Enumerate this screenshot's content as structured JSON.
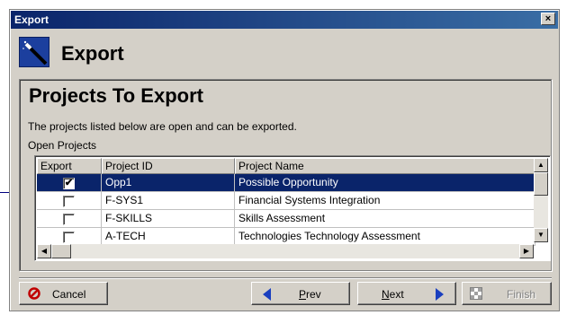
{
  "window": {
    "title": "Export",
    "close_glyph": "×"
  },
  "header": {
    "title": "Export",
    "icon": "wand-icon"
  },
  "panel": {
    "title": "Projects To Export",
    "description": "The projects listed below are open and can be exported.",
    "list_label": "Open Projects"
  },
  "table": {
    "columns": [
      "Export",
      "Project ID",
      "Project Name"
    ],
    "rows": [
      {
        "checked": true,
        "id": "Opp1",
        "name": "Possible Opportunity",
        "selected": true
      },
      {
        "checked": false,
        "id": "F-SYS1",
        "name": "Financial Systems Integration",
        "selected": false
      },
      {
        "checked": false,
        "id": "F-SKILLS",
        "name": "Skills Assessment",
        "selected": false
      },
      {
        "checked": false,
        "id": "A-TECH",
        "name": "Technologies Technology Assessment",
        "selected": false
      }
    ]
  },
  "buttons": {
    "cancel": "Cancel",
    "prev_u": "P",
    "prev_rest": "rev",
    "next_u": "N",
    "next_rest": "ext",
    "finish": "Finish"
  },
  "colors": {
    "selection": "#0a246a",
    "titlebar": "#0a246a",
    "cancel_icon": "#c00000",
    "arrow": "#1a3fbf"
  }
}
